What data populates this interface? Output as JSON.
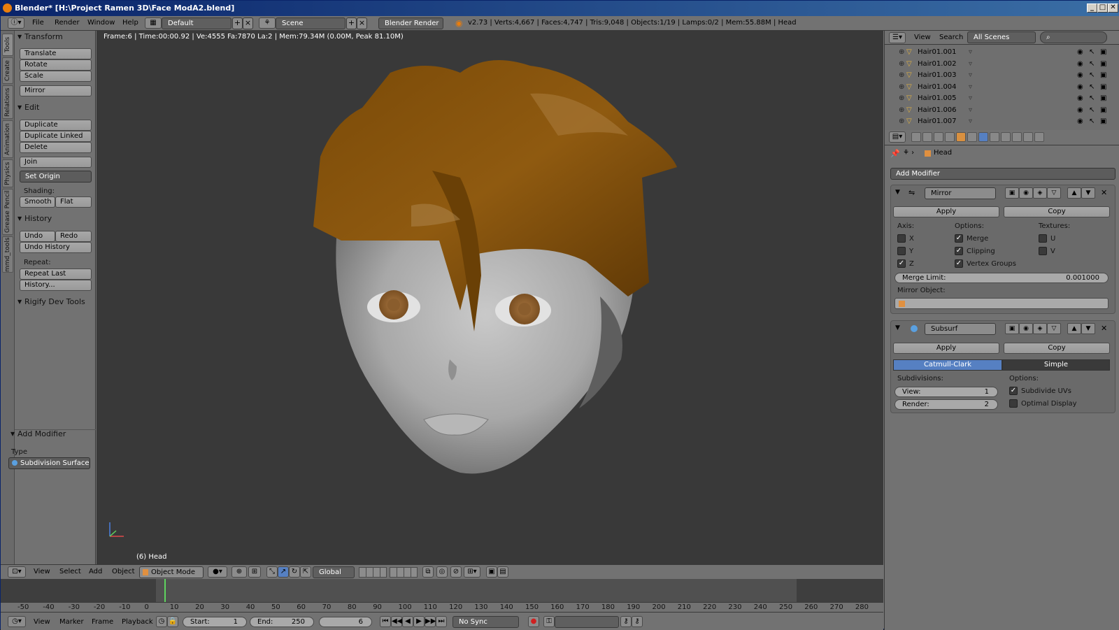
{
  "window": {
    "title": "Blender* [H:\\Project Ramen 3D\\Face ModA2.blend]",
    "controls": [
      "_",
      "□",
      "✕"
    ]
  },
  "infobar": {
    "menus": [
      "File",
      "Render",
      "Window",
      "Help"
    ],
    "layout": "Default",
    "scene": "Scene",
    "engine": "Blender Render",
    "stats": "v2.73 | Verts:4,667 | Faces:4,747 | Tris:9,048 | Objects:1/19 | Lamps:0/2 | Mem:55.88M | Head"
  },
  "lefttabs": [
    "Tools",
    "Create",
    "Relations",
    "Animation",
    "Physics",
    "Grease Pencil",
    "mmd_tools"
  ],
  "toolshelf": {
    "transform": {
      "header": "Transform",
      "translate": "Translate",
      "rotate": "Rotate",
      "scale": "Scale",
      "mirror": "Mirror"
    },
    "edit": {
      "header": "Edit",
      "duplicate": "Duplicate",
      "duplicate_linked": "Duplicate Linked",
      "delete": "Delete",
      "join": "Join",
      "set_origin": "Set Origin",
      "shading_label": "Shading:",
      "smooth": "Smooth",
      "flat": "Flat"
    },
    "history": {
      "header": "History",
      "undo": "Undo",
      "redo": "Redo",
      "undo_history": "Undo History",
      "repeat_label": "Repeat:",
      "repeat_last": "Repeat Last",
      "history": "History..."
    },
    "rigify": {
      "header": "Rigify Dev Tools"
    },
    "operator": {
      "header": "Add Modifier",
      "type_label": "Type",
      "type_value": "Subdivision Surface"
    }
  },
  "viewport": {
    "info": "Frame:6 | Time:00:00.92 | Ve:4555 Fa:7870 La:2 | Mem:79.34M (0.00M, Peak 81.10M)",
    "object_label": "(6) Head"
  },
  "viewport_header": {
    "menus": [
      "View",
      "Select",
      "Add",
      "Object"
    ],
    "mode": "Object Mode",
    "orientation": "Global"
  },
  "timeline": {
    "ticks": [
      "-50",
      "-40",
      "-30",
      "-20",
      "-10",
      "0",
      "10",
      "20",
      "30",
      "40",
      "50",
      "60",
      "70",
      "80",
      "90",
      "100",
      "110",
      "120",
      "130",
      "140",
      "150",
      "160",
      "170",
      "180",
      "190",
      "200",
      "210",
      "220",
      "230",
      "240",
      "250",
      "260",
      "270",
      "280"
    ],
    "menus": [
      "View",
      "Marker",
      "Frame",
      "Playback"
    ],
    "start_label": "Start:",
    "start_value": "1",
    "end_label": "End:",
    "end_value": "250",
    "current_frame": "6",
    "sync": "No Sync"
  },
  "outliner": {
    "menus": [
      "View",
      "Search"
    ],
    "scope": "All Scenes",
    "items": [
      "Hair01.001",
      "Hair01.002",
      "Hair01.003",
      "Hair01.004",
      "Hair01.005",
      "Hair01.006",
      "Hair01.007"
    ]
  },
  "properties": {
    "context_object": "Head",
    "add_modifier": "Add Modifier",
    "mirror": {
      "name": "Mirror",
      "apply": "Apply",
      "copy": "Copy",
      "axis_label": "Axis:",
      "options_label": "Options:",
      "textures_label": "Textures:",
      "x": "X",
      "y": "Y",
      "z": "Z",
      "merge": "Merge",
      "clipping": "Clipping",
      "vertex_groups": "Vertex Groups",
      "u": "U",
      "v": "V",
      "merge_limit_label": "Merge Limit:",
      "merge_limit_value": "0.001000",
      "mirror_object_label": "Mirror Object:"
    },
    "subsurf": {
      "name": "Subsurf",
      "apply": "Apply",
      "copy": "Copy",
      "catmull": "Catmull-Clark",
      "simple": "Simple",
      "subdivisions_label": "Subdivisions:",
      "options_label": "Options:",
      "view_label": "View:",
      "view_value": "1",
      "render_label": "Render:",
      "render_value": "2",
      "subdivide_uvs": "Subdivide UVs",
      "optimal_display": "Optimal Display"
    }
  }
}
